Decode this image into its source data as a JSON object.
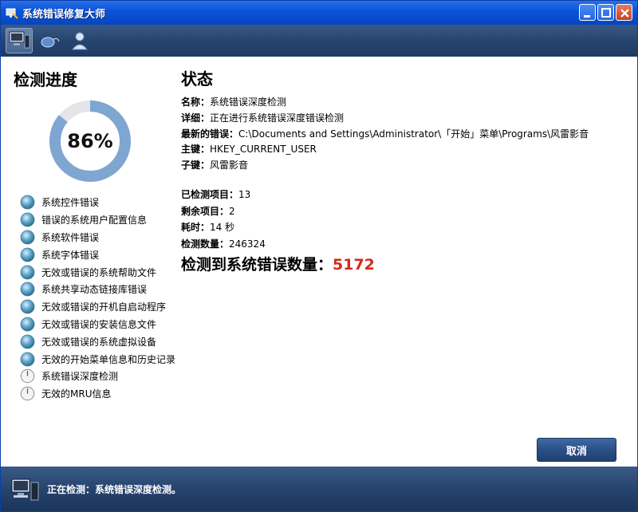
{
  "window": {
    "title": "系统错误修复大师"
  },
  "toolbar": {
    "tools": [
      "computer-icon",
      "mouse-icon",
      "user-icon"
    ]
  },
  "left": {
    "title": "检测进度",
    "progress_percent": 86,
    "progress_label": "86%",
    "items": [
      {
        "label": "系统控件错误",
        "state": "done"
      },
      {
        "label": "错误的系统用户配置信息",
        "state": "done"
      },
      {
        "label": "系统软件错误",
        "state": "done"
      },
      {
        "label": "系统字体错误",
        "state": "done"
      },
      {
        "label": "无效或错误的系统帮助文件",
        "state": "done"
      },
      {
        "label": "系统共享动态链接库错误",
        "state": "done"
      },
      {
        "label": "无效或错误的开机自启动程序",
        "state": "done"
      },
      {
        "label": "无效或错误的安装信息文件",
        "state": "done"
      },
      {
        "label": "无效或错误的系统虚拟设备",
        "state": "done"
      },
      {
        "label": "无效的开始菜单信息和历史记录",
        "state": "done"
      },
      {
        "label": "系统错误深度检测",
        "state": "pending"
      },
      {
        "label": "无效的MRU信息",
        "state": "pending"
      }
    ]
  },
  "status": {
    "title": "状态",
    "name_key": "名称：",
    "name_val": "系统错误深度检测",
    "detail_key": "详细：",
    "detail_val": "正在进行系统错误深度错误检测",
    "latest_key": "最新的错误：",
    "latest_val": "C:\\Documents and Settings\\Administrator\\「开始」菜单\\Programs\\风雷影音",
    "mainkey_key": "主键：",
    "mainkey_val": "HKEY_CURRENT_USER",
    "subkey_key": "子键：",
    "subkey_val": "风雷影音",
    "checked_key": "已检测项目：",
    "checked_val": "13",
    "remaining_key": "剩余项目：",
    "remaining_val": "2",
    "elapsed_key": "耗时：",
    "elapsed_val": "14 秒",
    "count_key": "检测数量：",
    "count_val": "246324",
    "errors_label": "检测到系统错误数量：",
    "errors_val": "5172"
  },
  "actions": {
    "cancel_label": "取消"
  },
  "footer": {
    "status_text": "正在检测：系统错误深度检测。"
  },
  "colors": {
    "accent": "#7ea6d1",
    "error_count": "#d42a1c",
    "bar": "#26446e"
  }
}
